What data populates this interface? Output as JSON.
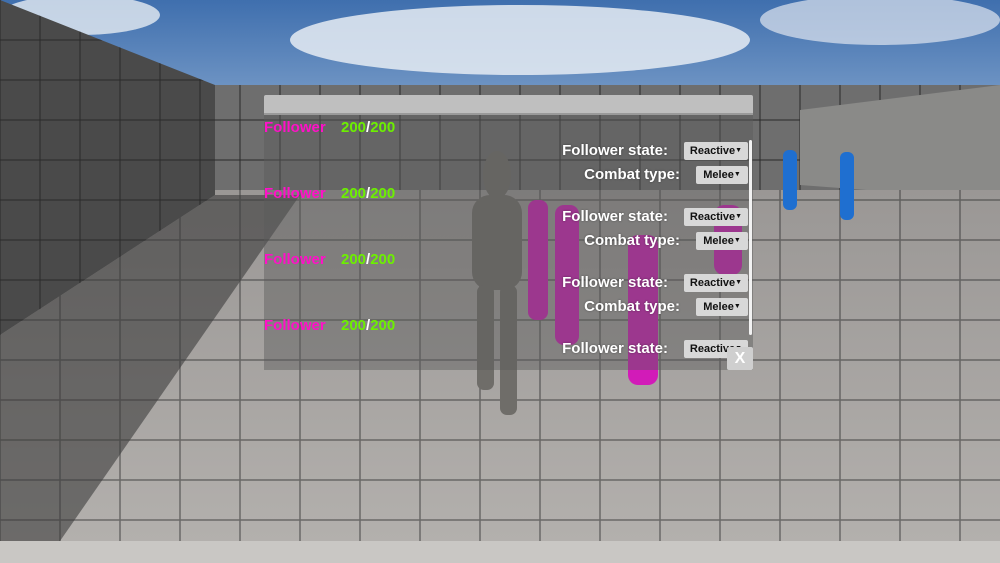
{
  "window": {
    "close_label": "X"
  },
  "followers": [
    {
      "name": "Follower",
      "hp": "200",
      "hp_max": "200",
      "slash": "/",
      "state_label": "Follower state:",
      "state_value": "Reactive",
      "combat_label": "Combat type:",
      "combat_value": "Melee"
    },
    {
      "name": "Follower",
      "hp": "200",
      "hp_max": "200",
      "slash": "/",
      "state_label": "Follower state:",
      "state_value": "Reactive",
      "combat_label": "Combat type:",
      "combat_value": "Melee"
    },
    {
      "name": "Follower",
      "hp": "200",
      "hp_max": "200",
      "slash": "/",
      "state_label": "Follower state:",
      "state_value": "Reactive",
      "combat_label": "Combat type:",
      "combat_value": "Melee"
    },
    {
      "name": "Follower",
      "hp": "200",
      "hp_max": "200",
      "slash": "/",
      "state_label": "Follower state:",
      "state_value": "Reactive"
    }
  ],
  "colors": {
    "name": "#ff10c8",
    "hp": "#6cf000",
    "panel_title": "#bfbfbf"
  }
}
